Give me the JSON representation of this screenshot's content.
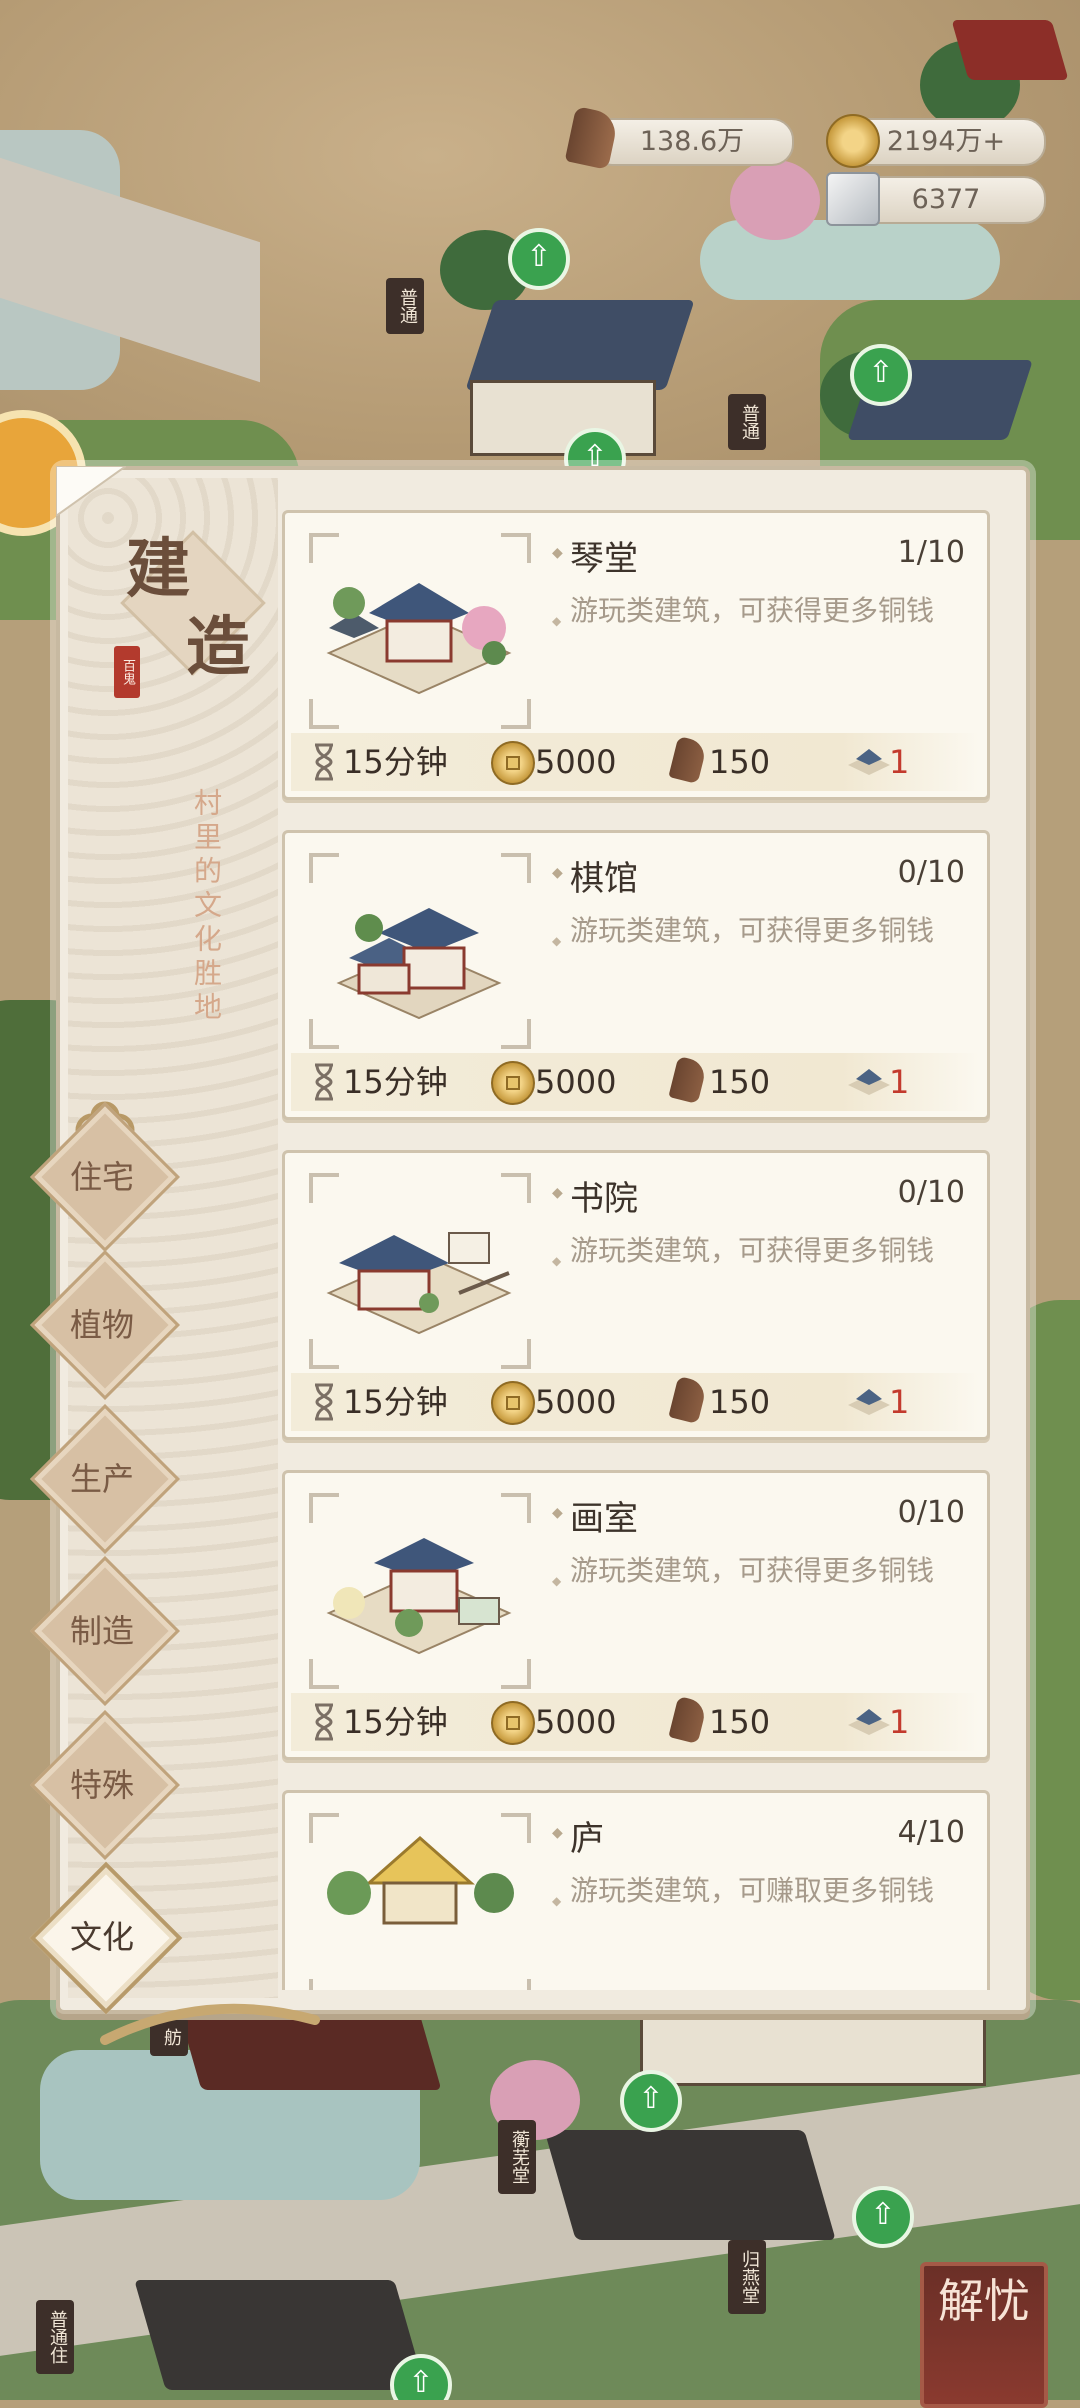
{
  "resources": {
    "wood": "138.6万",
    "coins": "2194万+",
    "stone": "6377"
  },
  "panel": {
    "title_char1": "建",
    "title_char2": "造",
    "seal_text": "百鬼",
    "subtitle": "村里的文化胜地"
  },
  "categories": [
    {
      "label": "住宅",
      "active": false
    },
    {
      "label": "植物",
      "active": false
    },
    {
      "label": "生产",
      "active": false
    },
    {
      "label": "制造",
      "active": false
    },
    {
      "label": "特殊",
      "active": false
    },
    {
      "label": "文化",
      "active": true
    }
  ],
  "buildings": [
    {
      "name": "琴堂",
      "count": "1/10",
      "desc": "游玩类建筑，可获得更多铜钱",
      "time": "15分钟",
      "coin_cost": "5000",
      "wood_cost": "150",
      "req": "1"
    },
    {
      "name": "棋馆",
      "count": "0/10",
      "desc": "游玩类建筑，可获得更多铜钱",
      "time": "15分钟",
      "coin_cost": "5000",
      "wood_cost": "150",
      "req": "1"
    },
    {
      "name": "书院",
      "count": "0/10",
      "desc": "游玩类建筑，可获得更多铜钱",
      "time": "15分钟",
      "coin_cost": "5000",
      "wood_cost": "150",
      "req": "1"
    },
    {
      "name": "画室",
      "count": "0/10",
      "desc": "游玩类建筑，可获得更多铜钱",
      "time": "15分钟",
      "coin_cost": "5000",
      "wood_cost": "150",
      "req": "1"
    },
    {
      "name": "庐",
      "count": "4/10",
      "desc": "游玩类建筑，可赚取更多铜钱",
      "time": "",
      "coin_cost": "",
      "wood_cost": "",
      "req": ""
    }
  ],
  "map_signs": {
    "s1": "普通",
    "s2": "普通",
    "s3": "舫",
    "s4": "蘅芜堂",
    "s5": "归燕堂",
    "s6": "普通住"
  },
  "solve_button": "解忧",
  "colors": {
    "panel_bg": "#f1ebe0",
    "card_bg": "#fbf8ef",
    "accent_red": "#c33a2d",
    "upgrade_green": "#3aa24f"
  }
}
